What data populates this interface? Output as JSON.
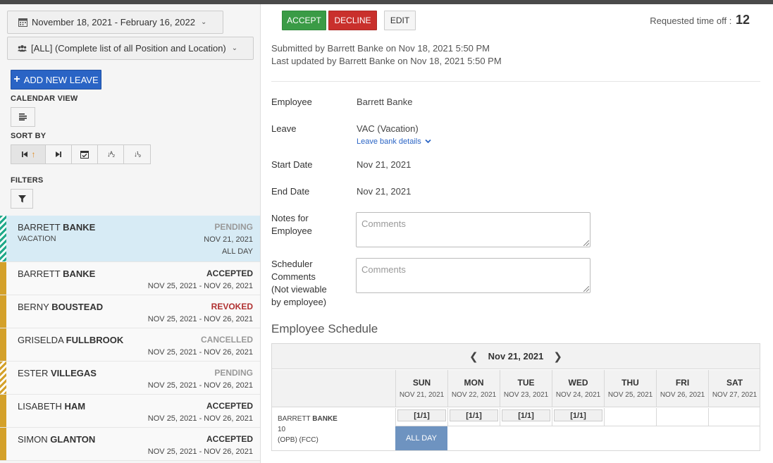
{
  "filters": {
    "date_range": "November 18, 2021 - February 16, 2022",
    "location": "[ALL] (Complete list of all Position and Location)"
  },
  "left": {
    "add_new_leave": "ADD NEW LEAVE",
    "calendar_view_label": "CALENDAR VIEW",
    "sort_by_label": "SORT BY",
    "filters_label": "FILTERS"
  },
  "leave_list": [
    {
      "first": "BARRETT",
      "last": "BANKE",
      "status": "PENDING",
      "type": "VACATION",
      "dates": "NOV 21, 2021",
      "allday": "ALL DAY"
    },
    {
      "first": "BARRETT",
      "last": "BANKE",
      "status": "ACCEPTED",
      "dates": "NOV 25, 2021 - NOV 26, 2021"
    },
    {
      "first": "BERNY",
      "last": "BOUSTEAD",
      "status": "REVOKED",
      "dates": "NOV 25, 2021 - NOV 26, 2021"
    },
    {
      "first": "GRISELDA",
      "last": "FULLBROOK",
      "status": "CANCELLED",
      "dates": "NOV 25, 2021 - NOV 26, 2021"
    },
    {
      "first": "ESTER",
      "last": "VILLEGAS",
      "status": "PENDING",
      "dates": "NOV 25, 2021 - NOV 26, 2021"
    },
    {
      "first": "LISABETH",
      "last": "HAM",
      "status": "ACCEPTED",
      "dates": "NOV 25, 2021 - NOV 26, 2021"
    },
    {
      "first": "SIMON",
      "last": "GLANTON",
      "status": "ACCEPTED",
      "dates": "NOV 25, 2021 - NOV 26, 2021"
    }
  ],
  "toolbar": {
    "accept": "ACCEPT",
    "decline": "DECLINE",
    "edit": "EDIT",
    "requested_label": "Requested time off :",
    "requested_value": "12"
  },
  "detail": {
    "submitted": "Submitted by Barrett Banke on Nov 18, 2021 5:50 PM",
    "updated": "Last updated by Barrett Banke on Nov 18, 2021 5:50 PM",
    "employee_label": "Employee",
    "employee_value": "Barrett Banke",
    "leave_label": "Leave",
    "leave_value": "VAC (Vacation)",
    "leave_bank_link": "Leave bank details",
    "start_label": "Start Date",
    "start_value": "Nov 21, 2021",
    "end_label": "End Date",
    "end_value": "Nov 21, 2021",
    "notes_label_1": "Notes for",
    "notes_label_2": "Employee",
    "notes_placeholder": "Comments",
    "sched_label_1": "Scheduler",
    "sched_label_2": "Comments",
    "sched_label_3": "(Not viewable",
    "sched_label_4": "by employee)",
    "sched_placeholder": "Comments"
  },
  "schedule": {
    "title": "Employee Schedule",
    "week_label": "Nov 21, 2021",
    "days": [
      {
        "name": "SUN",
        "date": "NOV 21, 2021"
      },
      {
        "name": "MON",
        "date": "NOV 22, 2021"
      },
      {
        "name": "TUE",
        "date": "NOV 23, 2021"
      },
      {
        "name": "WED",
        "date": "NOV 24, 2021"
      },
      {
        "name": "THU",
        "date": "NOV 25, 2021"
      },
      {
        "name": "FRI",
        "date": "NOV 26, 2021"
      },
      {
        "name": "SAT",
        "date": "NOV 27, 2021"
      }
    ],
    "employee": {
      "first": "BARRETT",
      "last": "BANKE",
      "number": "10",
      "codes": "(OPB) (FCC)"
    },
    "shifts": [
      "[1/1]",
      "[1/1]",
      "[1/1]",
      "[1/1]"
    ],
    "allday": "ALL DAY"
  }
}
